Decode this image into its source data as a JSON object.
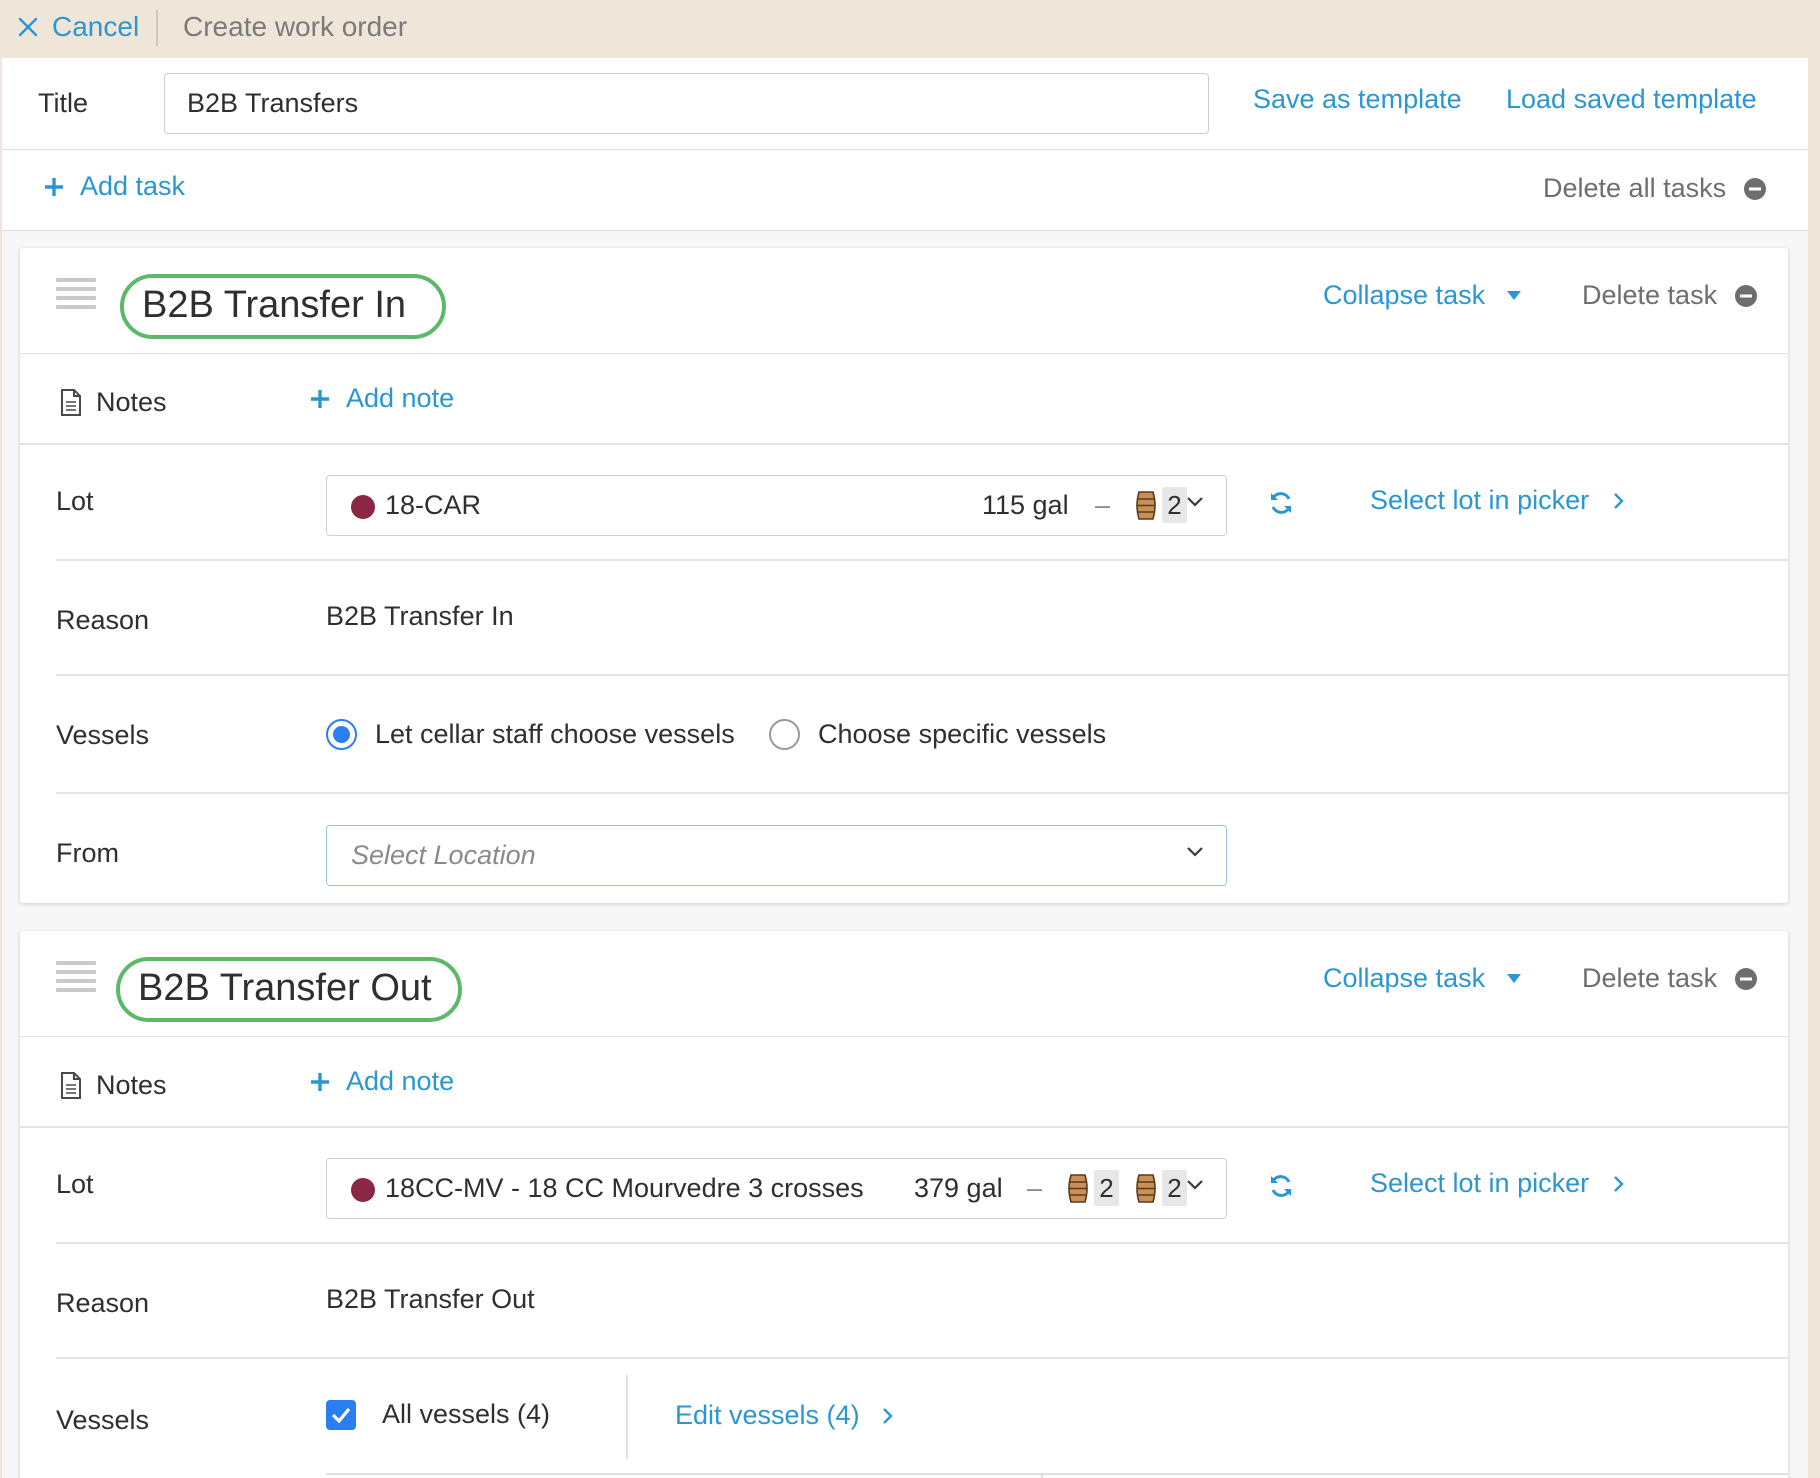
{
  "topbar": {
    "cancel_label": "Cancel",
    "heading": "Create work order"
  },
  "title_row": {
    "label": "Title",
    "value": "B2B Transfers",
    "save_template": "Save as template",
    "load_template": "Load saved template"
  },
  "tasks_row": {
    "add_task": "Add task",
    "delete_all": "Delete all tasks"
  },
  "colors": {
    "accent": "#2a96d2",
    "highlight": "#5cb96a",
    "wine": "#8a2742",
    "control": "#2a7ff0"
  },
  "labels": {
    "notes": "Notes",
    "add_note": "Add note",
    "lot": "Lot",
    "reason": "Reason",
    "vessels": "Vessels",
    "from": "From",
    "collapse_task": "Collapse task",
    "delete_task": "Delete task",
    "select_lot_in_picker": "Select lot in picker"
  },
  "tasks": [
    {
      "title": "B2B Transfer In",
      "lot": {
        "name": "18-CAR",
        "volume": "115 gal",
        "dash": "–",
        "barrels": [
          {
            "icon": "barrel-icon",
            "count": "2"
          }
        ]
      },
      "reason": "B2B Transfer In",
      "vessels": {
        "options": [
          "Let cellar staff choose vessels",
          "Choose specific vessels"
        ],
        "selected": 0
      },
      "from": {
        "placeholder": "Select Location",
        "value": ""
      }
    },
    {
      "title": "B2B Transfer Out",
      "lot": {
        "name": "18CC-MV - 18 CC Mourvedre 3 crosses",
        "volume": "379 gal",
        "dash": "–",
        "barrels": [
          {
            "icon": "barrel-icon",
            "count": "2"
          },
          {
            "icon": "barrel-icon",
            "count": "2"
          }
        ]
      },
      "reason": "B2B Transfer Out",
      "vessels": {
        "all_label": "All vessels (4)",
        "checked": true,
        "edit_label": "Edit vessels (4)"
      }
    }
  ]
}
